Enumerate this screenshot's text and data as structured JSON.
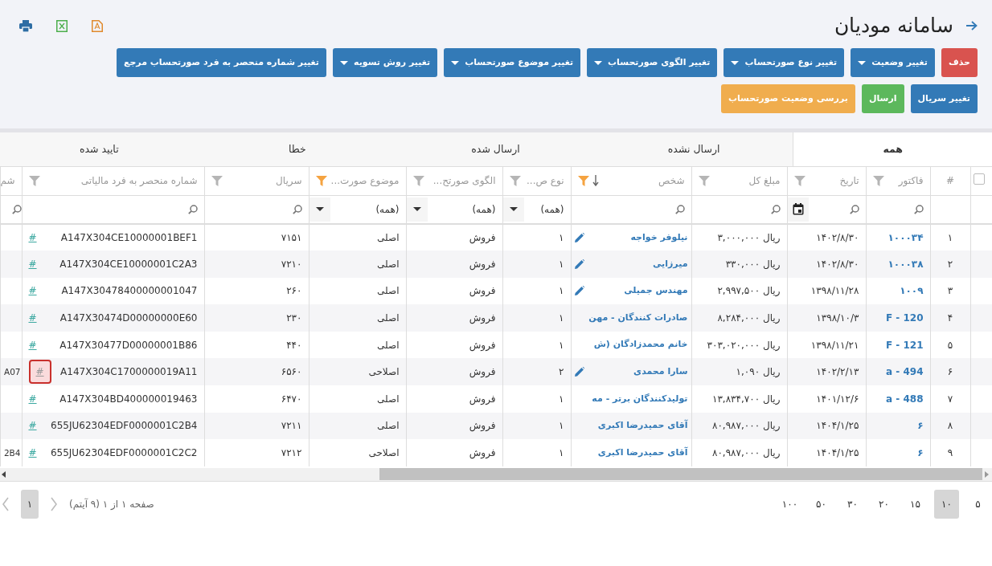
{
  "header": {
    "title": "سامانه مودیان"
  },
  "toolbar": {
    "rows": [
      [
        {
          "label": "حذف",
          "kind": "delete",
          "dropdown": false
        },
        {
          "label": "تغییر وضعیت",
          "kind": "change",
          "dropdown": true
        },
        {
          "label": "تغییر نوع صورتحساب",
          "kind": "change",
          "dropdown": true
        },
        {
          "label": "تغییر الگوی صورتحساب",
          "kind": "change",
          "dropdown": true
        },
        {
          "label": "تغییر موضوع صورتحساب",
          "kind": "change",
          "dropdown": true
        },
        {
          "label": "تغییر روش تسویه",
          "kind": "change",
          "dropdown": true
        },
        {
          "label": "تغییر شماره منحصر به فرد صورتحساب مرجع",
          "kind": "change",
          "dropdown": false
        }
      ],
      [
        {
          "label": "تغییر سریال",
          "kind": "change",
          "dropdown": false
        },
        {
          "label": "ارسال",
          "kind": "send",
          "dropdown": false
        },
        {
          "label": "بررسی وضعیت صورتحساب",
          "kind": "inquiry",
          "dropdown": false
        }
      ]
    ]
  },
  "tabs": [
    {
      "label": "همه",
      "selected": true
    },
    {
      "label": "ارسال نشده",
      "selected": false
    },
    {
      "label": "ارسال شده",
      "selected": false
    },
    {
      "label": "خطا",
      "selected": false
    },
    {
      "label": "تایید شده",
      "selected": false
    }
  ],
  "table": {
    "select_all": {
      "checked": false
    },
    "columns": [
      {
        "kind": "index",
        "label": "#"
      },
      {
        "kind": "link",
        "label": "فاکتور",
        "filter": {
          "kind": "search"
        },
        "filter_active": false,
        "sorted": false
      },
      {
        "kind": "text",
        "label": "تاریخ",
        "filter": {
          "kind": "date"
        },
        "filter_active": false,
        "sorted": false
      },
      {
        "kind": "text",
        "label": "مبلغ کل",
        "filter": {
          "kind": "search"
        },
        "filter_active": false,
        "sorted": false
      },
      {
        "kind": "person",
        "label": "شخص",
        "filter": {
          "kind": "search"
        },
        "filter_active": true,
        "sorted": true
      },
      {
        "kind": "text",
        "label": "نوع ص...",
        "filter": {
          "kind": "select",
          "value": "(همه)"
        },
        "filter_active": false,
        "sorted": false
      },
      {
        "kind": "text",
        "label": "الگوی صورتح...",
        "filter": {
          "kind": "select",
          "value": "(همه)"
        },
        "filter_active": false,
        "sorted": false
      },
      {
        "kind": "text",
        "label": "موضوع صورت...",
        "filter": {
          "kind": "select",
          "value": "(همه)"
        },
        "filter_active": true,
        "sorted": false
      },
      {
        "kind": "text",
        "label": "سریال",
        "filter": {
          "kind": "search"
        },
        "filter_active": false,
        "sorted": false
      },
      {
        "kind": "tax",
        "label": "شماره منحصر به فرد مالیاتی",
        "filter": {
          "kind": "search"
        },
        "filter_active": false,
        "sorted": false
      },
      {
        "kind": "cut",
        "label": "شم",
        "filter": {
          "kind": "search"
        }
      }
    ],
    "rows": [
      {
        "cells": [
          "۱",
          "۱۰۰۰۳۴",
          "۱۴۰۲/۸/۳۰",
          "ریال ۳,۰۰۰,۰۰۰",
          "نیلوفر خواجه",
          "۱",
          "فروش",
          "اصلی",
          "۷۱۵۱",
          "A147X304CE10000001BEF1",
          ""
        ],
        "editable": true,
        "link": "#",
        "link_focused": false
      },
      {
        "cells": [
          "۲",
          "۱۰۰۰۳۸",
          "۱۴۰۲/۸/۳۰",
          "ریال ۳۳۰,۰۰۰",
          "میرزایی",
          "۱",
          "فروش",
          "اصلی",
          "۷۲۱۰",
          "A147X304CE10000001C2A3",
          ""
        ],
        "editable": true,
        "link": "#",
        "link_focused": false
      },
      {
        "cells": [
          "۳",
          "۱۰۰۹",
          "۱۳۹۸/۱۱/۲۸",
          "ریال ۲,۹۹۷,۵۰۰",
          "مهندس جمیلی",
          "۱",
          "فروش",
          "اصلی",
          "۲۶۰",
          "A147X30478400000001047",
          ""
        ],
        "editable": true,
        "link": "#",
        "link_focused": false
      },
      {
        "cells": [
          "۴",
          "F - 120",
          "۱۳۹۸/۱۰/۳",
          "ریال ۸,۲۸۴,۰۰۰",
          "صادرات کنندگان - مهن",
          "۱",
          "فروش",
          "اصلی",
          "۲۳۰",
          "A147X30474D00000000E60",
          ""
        ],
        "editable": false,
        "link": "#",
        "link_focused": false
      },
      {
        "cells": [
          "۵",
          "F - 121",
          "۱۳۹۸/۱۱/۲۱",
          "ریال ۳۰۳,۰۲۰,۰۰۰",
          "خانم محمدزادگان (ش",
          "۱",
          "فروش",
          "اصلی",
          "۴۴۰",
          "A147X30477D00000001B86",
          ""
        ],
        "editable": false,
        "link": "#",
        "link_focused": false
      },
      {
        "cells": [
          "۶",
          "a - 494",
          "۱۴۰۲/۲/۱۳",
          "ریال ۱,۰۹۰",
          "سارا محمدی",
          "۲",
          "فروش",
          "اصلاحی",
          "۶۵۶۰",
          "A147X304C1700000019A11",
          "A07"
        ],
        "editable": true,
        "link": "#",
        "link_focused": true
      },
      {
        "cells": [
          "۷",
          "a - 488",
          "۱۴۰۱/۱۲/۶",
          "ریال ۱۳,۸۳۴,۷۰۰",
          "تولیدکنندگان برتر - مه",
          "۱",
          "فروش",
          "اصلی",
          "۶۴۷۰",
          "A147X304BD400000019463",
          ""
        ],
        "editable": false,
        "link": "#",
        "link_focused": false
      },
      {
        "cells": [
          "۸",
          "۶",
          "۱۴۰۴/۱/۲۵",
          "ریال ۸۰,۹۸۷,۰۰۰",
          "آقای حمیدرضا اکبری",
          "۱",
          "فروش",
          "اصلی",
          "۷۲۱۱",
          "655JU62304EDF0000001C2B4",
          ""
        ],
        "editable": false,
        "link": "#",
        "link_focused": false
      },
      {
        "cells": [
          "۹",
          "۶",
          "۱۴۰۴/۱/۲۵",
          "ریال ۸۰,۹۸۷,۰۰۰",
          "آقای حمیدرضا اکبری",
          "۱",
          "فروش",
          "اصلاحی",
          "۷۲۱۲",
          "655JU62304EDF0000001C2C2",
          "2B4"
        ],
        "editable": false,
        "link": "#",
        "link_focused": false
      }
    ]
  },
  "pager": {
    "page_sizes": [
      {
        "label": "۵",
        "selected": false
      },
      {
        "label": "۱۰",
        "selected": true
      },
      {
        "label": "۱۵",
        "selected": false
      },
      {
        "label": "۲۰",
        "selected": false
      },
      {
        "label": "۳۰",
        "selected": false
      },
      {
        "label": "۵۰",
        "selected": false
      },
      {
        "label": "۱۰۰",
        "selected": false
      }
    ],
    "info": "صفحه ۱ از ۱ (۹ آیتم)",
    "pages": [
      {
        "label": "۱",
        "selected": true
      }
    ]
  }
}
